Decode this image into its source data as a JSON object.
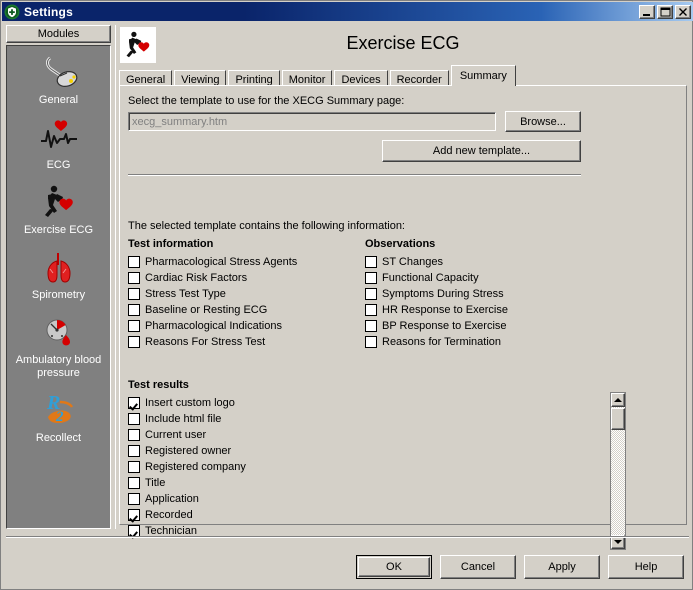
{
  "window": {
    "title": "Settings",
    "icon": "shield-icon",
    "buttons": {
      "minimize": "minimize-icon",
      "maximize": "maximize-icon",
      "close": "close-icon"
    },
    "titlebar_color": "#0a246a"
  },
  "sidebar": {
    "header_label": "Modules",
    "background": "#808080",
    "items": [
      {
        "label": "General",
        "icon": "mouse-icon"
      },
      {
        "label": "ECG",
        "icon": "ecg-waveform-heart-icon"
      },
      {
        "label": "Exercise ECG",
        "icon": "runner-heart-icon"
      },
      {
        "label": "Spirometry",
        "icon": "lungs-icon"
      },
      {
        "label": "Ambulatory blood pressure",
        "icon": "bp-cuff-icon"
      },
      {
        "label": "Recollect",
        "icon": "recollect-logo-icon"
      }
    ]
  },
  "header": {
    "page_title": "Exercise ECG",
    "icon": "runner-heart-icon"
  },
  "tabs": [
    {
      "label": "General",
      "active": false
    },
    {
      "label": "Viewing",
      "active": false
    },
    {
      "label": "Printing",
      "active": false
    },
    {
      "label": "Monitor",
      "active": false
    },
    {
      "label": "Devices",
      "active": false
    },
    {
      "label": "Recorder",
      "active": false
    },
    {
      "label": "Summary",
      "active": true
    }
  ],
  "summary": {
    "template_label": "Select the template to use for the XECG Summary page:",
    "template_value": "xecg_summary.htm",
    "browse_label": "Browse...",
    "add_template_label": "Add new template...",
    "contains_label": "The selected template contains the following information:",
    "groups": [
      {
        "title": "Test information",
        "items": [
          {
            "label": "Pharmacological Stress Agents",
            "checked": false
          },
          {
            "label": "Cardiac Risk Factors",
            "checked": false
          },
          {
            "label": "Stress Test Type",
            "checked": false
          },
          {
            "label": "Baseline or Resting ECG",
            "checked": false
          },
          {
            "label": "Pharmacological Indications",
            "checked": false
          },
          {
            "label": "Reasons For Stress Test",
            "checked": false
          }
        ]
      },
      {
        "title": "Observations",
        "items": [
          {
            "label": "ST Changes",
            "checked": false
          },
          {
            "label": "Functional Capacity",
            "checked": false
          },
          {
            "label": "Symptoms During Stress",
            "checked": false
          },
          {
            "label": "HR Response to Exercise",
            "checked": false
          },
          {
            "label": "BP Response to Exercise",
            "checked": false
          },
          {
            "label": "Reasons for Termination",
            "checked": false
          }
        ]
      },
      {
        "title": "Test results",
        "items": [
          {
            "label": "Insert custom logo",
            "checked": true
          },
          {
            "label": "Include html file",
            "checked": false
          },
          {
            "label": "Current user",
            "checked": false
          },
          {
            "label": "Registered owner",
            "checked": false
          },
          {
            "label": "Registered company",
            "checked": false
          },
          {
            "label": "Title",
            "checked": false
          },
          {
            "label": "Application",
            "checked": false
          },
          {
            "label": "Recorded",
            "checked": true
          },
          {
            "label": "Technician",
            "checked": true
          }
        ]
      }
    ],
    "scrollbar": {
      "up_icon": "scroll-up-arrow-icon",
      "down_icon": "scroll-down-arrow-icon"
    }
  },
  "footer": {
    "buttons": [
      {
        "label": "OK",
        "default": true
      },
      {
        "label": "Cancel",
        "default": false
      },
      {
        "label": "Apply",
        "default": false
      },
      {
        "label": "Help",
        "default": false
      }
    ]
  }
}
